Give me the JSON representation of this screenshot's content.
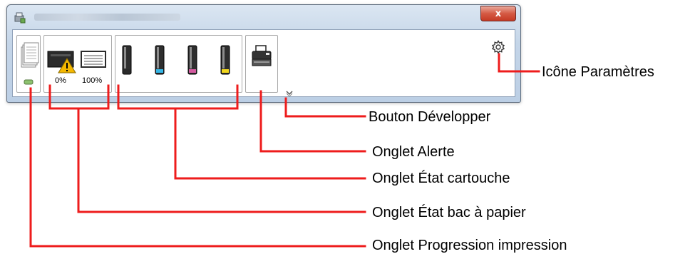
{
  "window": {
    "title_obscured": true,
    "close_label": "x"
  },
  "paper_tab": {
    "tray1_level": "0%",
    "tray2_level": "100%",
    "tray1_warning": true
  },
  "toner_tab": {
    "cartridges": [
      {
        "color_name": "black",
        "accent": "#2a2a2a"
      },
      {
        "color_name": "cyan",
        "accent": "#35b6e6"
      },
      {
        "color_name": "magenta",
        "accent": "#d45aa0"
      },
      {
        "color_name": "yellow",
        "accent": "#f1d61d"
      }
    ]
  },
  "callouts": {
    "settings": "Icône Paramètres",
    "expand": "Bouton Développer",
    "alert": "Onglet Alerte",
    "toner": "Onglet État cartouche",
    "paper": "Onglet État bac à papier",
    "progress": "Onglet Progression impression"
  },
  "colors": {
    "callout_line": "#ee1c1c",
    "window_frame": "#c4d5e8",
    "warning": "#f5b800"
  }
}
